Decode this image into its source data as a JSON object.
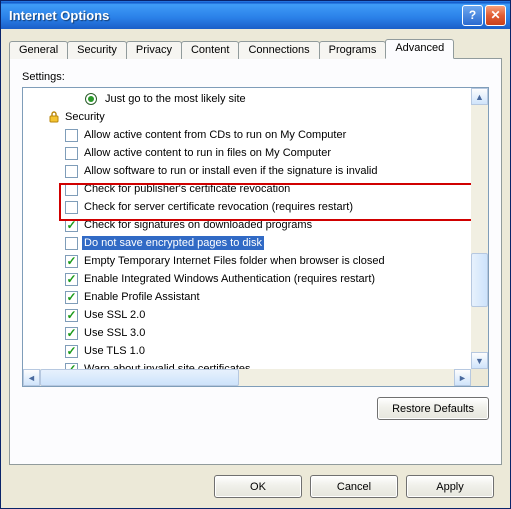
{
  "title": "Internet Options",
  "tabs": [
    "General",
    "Security",
    "Privacy",
    "Content",
    "Connections",
    "Programs",
    "Advanced"
  ],
  "active_tab": 6,
  "settings_label": "Settings:",
  "radio_item": {
    "label": "Just go to the most likely site",
    "checked": true
  },
  "group": {
    "label": "Security"
  },
  "items": [
    {
      "label": "Allow active content from CDs to run on My Computer",
      "checked": false,
      "selected": false
    },
    {
      "label": "Allow active content to run in files on My Computer",
      "checked": false,
      "selected": false
    },
    {
      "label": "Allow software to run or install even if the signature is invalid",
      "checked": false,
      "selected": false
    },
    {
      "label": "Check for publisher's certificate revocation",
      "checked": false,
      "selected": false
    },
    {
      "label": "Check for server certificate revocation (requires restart)",
      "checked": false,
      "selected": false
    },
    {
      "label": "Check for signatures on downloaded programs",
      "checked": true,
      "selected": false
    },
    {
      "label": "Do not save encrypted pages to disk",
      "checked": false,
      "selected": true
    },
    {
      "label": "Empty Temporary Internet Files folder when browser is closed",
      "checked": true,
      "selected": false
    },
    {
      "label": "Enable Integrated Windows Authentication (requires restart)",
      "checked": true,
      "selected": false
    },
    {
      "label": "Enable Profile Assistant",
      "checked": true,
      "selected": false
    },
    {
      "label": "Use SSL 2.0",
      "checked": true,
      "selected": false
    },
    {
      "label": "Use SSL 3.0",
      "checked": true,
      "selected": false
    },
    {
      "label": "Use TLS 1.0",
      "checked": true,
      "selected": false
    },
    {
      "label": "Warn about invalid site certificates",
      "checked": true,
      "selected": false
    }
  ],
  "restore_label": "Restore Defaults",
  "buttons": {
    "ok": "OK",
    "cancel": "Cancel",
    "apply": "Apply"
  }
}
